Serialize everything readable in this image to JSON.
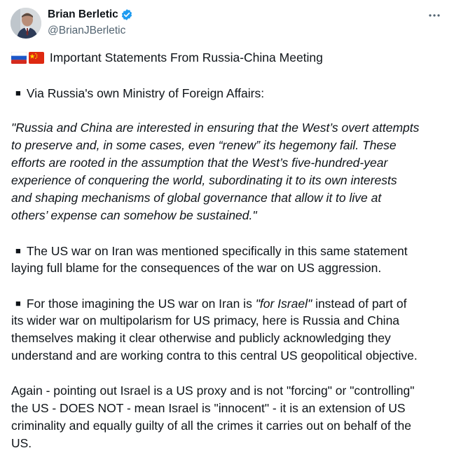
{
  "author": {
    "display_name": "Brian Berletic",
    "handle": "@BrianJBerletic",
    "verified": true,
    "verified_color": "#1d9bf0"
  },
  "menu": {
    "more_icon": "more-horizontal-icon"
  },
  "post": {
    "title_line": "Important Statements From Russia-China Meeting",
    "flags": [
      "flag-russia-icon",
      "flag-china-icon"
    ],
    "p1": "Via Russia's own Ministry of Foreign Affairs:",
    "quote_lines": [
      "\"Russia and China are interested in ensuring that the West’s overt attempts",
      "to preserve and, in some cases, even “renew” its hegemony fail. These",
      "efforts are rooted in the assumption that the West’s five-hundred-year",
      "experience of conquering the world, subordinating it to its own interests",
      "and shaping mechanisms of global governance that allow it to live at",
      "others’ expense can somehow be sustained.\""
    ],
    "p2_lines": [
      "The US war on Iran was mentioned specifically in this same statement",
      "laying full blame for the consequences of the war on US aggression."
    ],
    "p3_first_pre": "For those imagining the US war on Iran is ",
    "p3_first_em": "\"for Israel\"",
    "p3_first_post": " instead of part of",
    "p3_lines": [
      "its wider war on multipolarism for US primacy, here is Russia and China",
      "themselves making it clear otherwise and publicly acknowledging they",
      "understand and are working contra to this central US geopolitical objective."
    ],
    "p4_lines": [
      "Again - pointing out Israel is a US proxy and is not \"forcing\" or \"controlling\"",
      "the US - DOES NOT - mean Israel is \"innocent\" - it is an extension of US",
      "criminality and equally guilty of all the crimes it carries out on behalf of the",
      "US."
    ],
    "bullet_glyph": "■"
  }
}
